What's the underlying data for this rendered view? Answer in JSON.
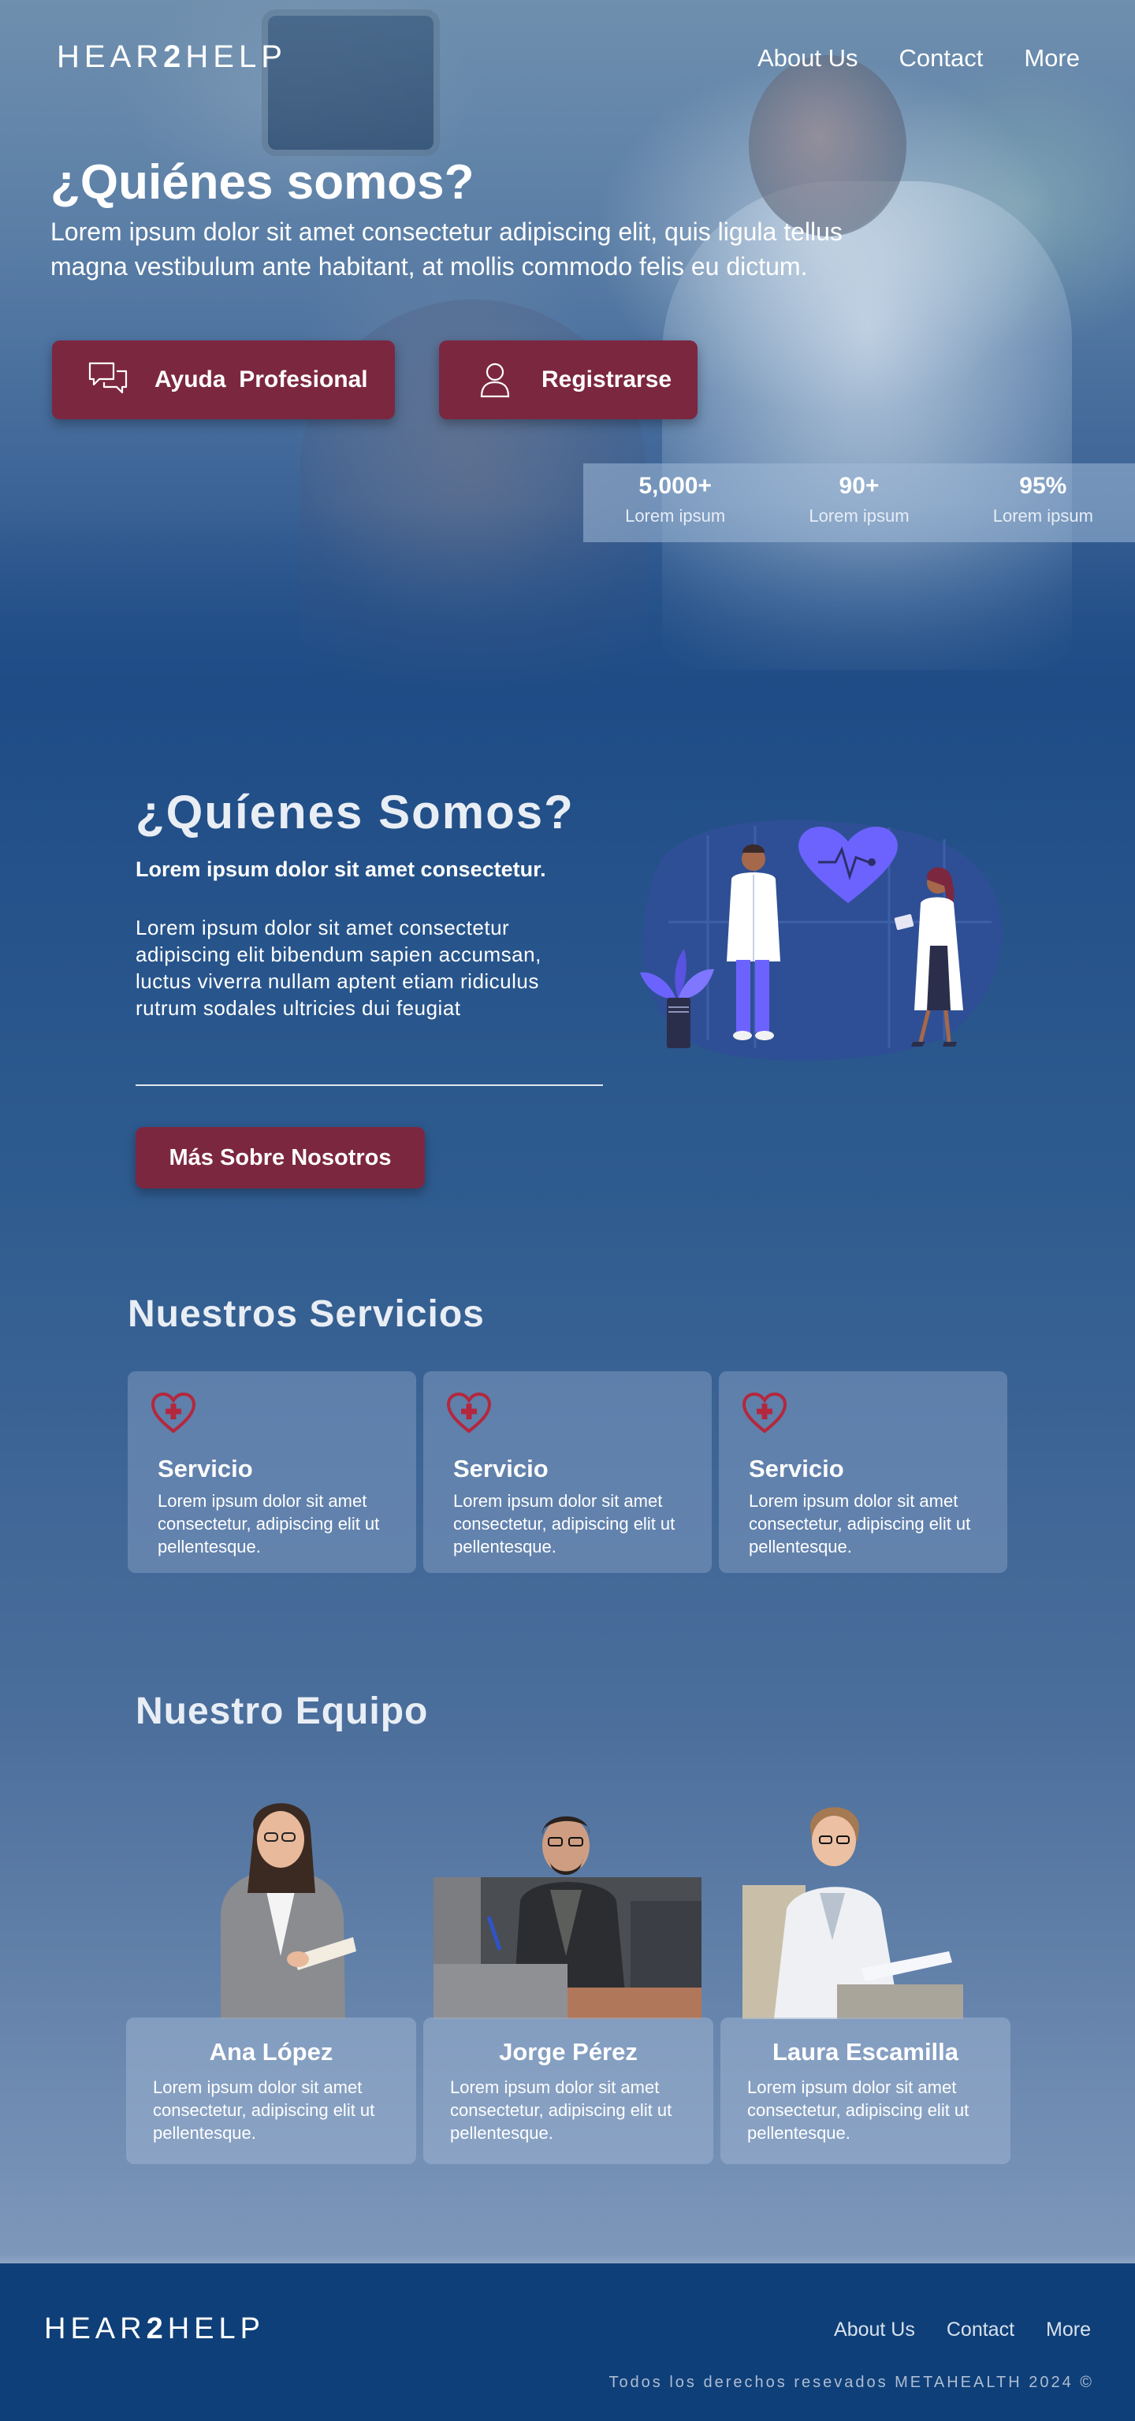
{
  "header": {
    "logo_prefix": "HEAR",
    "logo_number": "2",
    "logo_suffix": "HELP",
    "nav": [
      "About Us",
      "Contact",
      "More"
    ]
  },
  "hero": {
    "title": "¿Quiénes somos?",
    "text": "Lorem ipsum dolor sit amet consectetur adipiscing elit, quis ligula tellus magna vestibulum ante habitant, at mollis commodo felis eu dictum.",
    "help_button": "Ayuda  Profesional",
    "register_button": "Registrarse",
    "stats": [
      {
        "value": "5,000+",
        "label": "Lorem ipsum"
      },
      {
        "value": "90+",
        "label": "Lorem ipsum"
      },
      {
        "value": "95%",
        "label": "Lorem ipsum"
      }
    ]
  },
  "about": {
    "title": "¿Quíenes Somos?",
    "subtitle": "Lorem ipsum dolor sit amet consectetur.",
    "text": "Lorem ipsum dolor sit amet consectetur adipiscing elit bibendum sapien accumsan, luctus viverra nullam aptent etiam ridiculus rutrum sodales ultricies dui feugiat",
    "button": "Más Sobre Nosotros"
  },
  "services": {
    "title": "Nuestros Servicios",
    "items": [
      {
        "title": "Servicio",
        "text": "Lorem ipsum dolor sit amet consectetur, adipiscing elit ut pellentesque."
      },
      {
        "title": "Servicio",
        "text": "Lorem ipsum dolor sit amet consectetur, adipiscing elit ut pellentesque."
      },
      {
        "title": "Servicio",
        "text": "Lorem ipsum dolor sit amet consectetur, adipiscing elit ut pellentesque."
      }
    ]
  },
  "team": {
    "title": "Nuestro Equipo",
    "members": [
      {
        "name": "Ana López",
        "text": "Lorem ipsum dolor sit amet consectetur, adipiscing elit ut pellentesque."
      },
      {
        "name": "Jorge Pérez",
        "text": "Lorem ipsum dolor sit amet consectetur, adipiscing elit ut pellentesque."
      },
      {
        "name": "Laura Escamilla",
        "text": "Lorem ipsum dolor sit amet consectetur, adipiscing elit ut pellentesque."
      }
    ]
  },
  "footer": {
    "nav": [
      "About Us",
      "Contact",
      "More"
    ],
    "copyright": "Todos los derechos resevados METAHEALTH 2024 ©"
  },
  "colors": {
    "background": "#1f4c86",
    "button": "#7c2740",
    "footer": "#0f3f78",
    "heart_icon": "#b3283d",
    "illustration_accent": "#6c63ff"
  },
  "icons": [
    "chat-bubbles-icon",
    "user-icon",
    "heart-plus-icon",
    "heartbeat-icon",
    "plant-icon"
  ]
}
